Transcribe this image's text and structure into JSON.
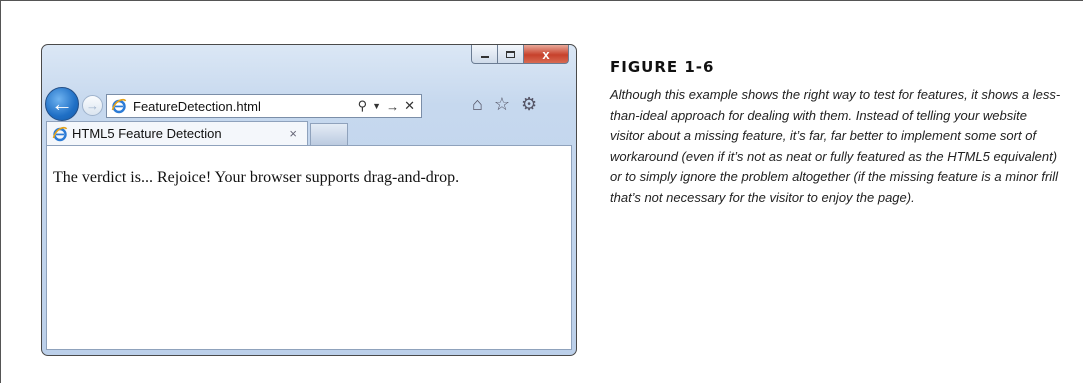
{
  "browser": {
    "address_url": "FeatureDetection.html",
    "tab_title": "HTML5 Feature Detection",
    "tab_close": "×",
    "close_glyph": "x",
    "page_content": "The verdict is... Rejoice! Your browser supports drag-and-drop."
  },
  "figure": {
    "title": "FIGURE 1-6",
    "caption": "Although this example shows the right way to test for features, it shows a less-than-ideal approach for dealing with them. Instead of telling your website visitor about a missing feature, it’s far, far better to implement some sort of workaround (even if it’s not as neat or fully featured as the HTML5 equivalent) or to simply ignore the problem altogether (if the missing feature is a minor frill that’s not necessary for the visitor to enjoy the page)."
  },
  "icons": {
    "back": "back-arrow-icon",
    "forward": "forward-arrow-icon",
    "search": "search-icon",
    "refresh": "refresh-icon",
    "stop": "stop-icon",
    "home": "home-icon",
    "favorites": "star-icon",
    "tools": "gear-icon"
  },
  "colors": {
    "back_button": "#1f6fc5",
    "close_button": "#c7412b",
    "chrome": "#c6d8ee"
  }
}
